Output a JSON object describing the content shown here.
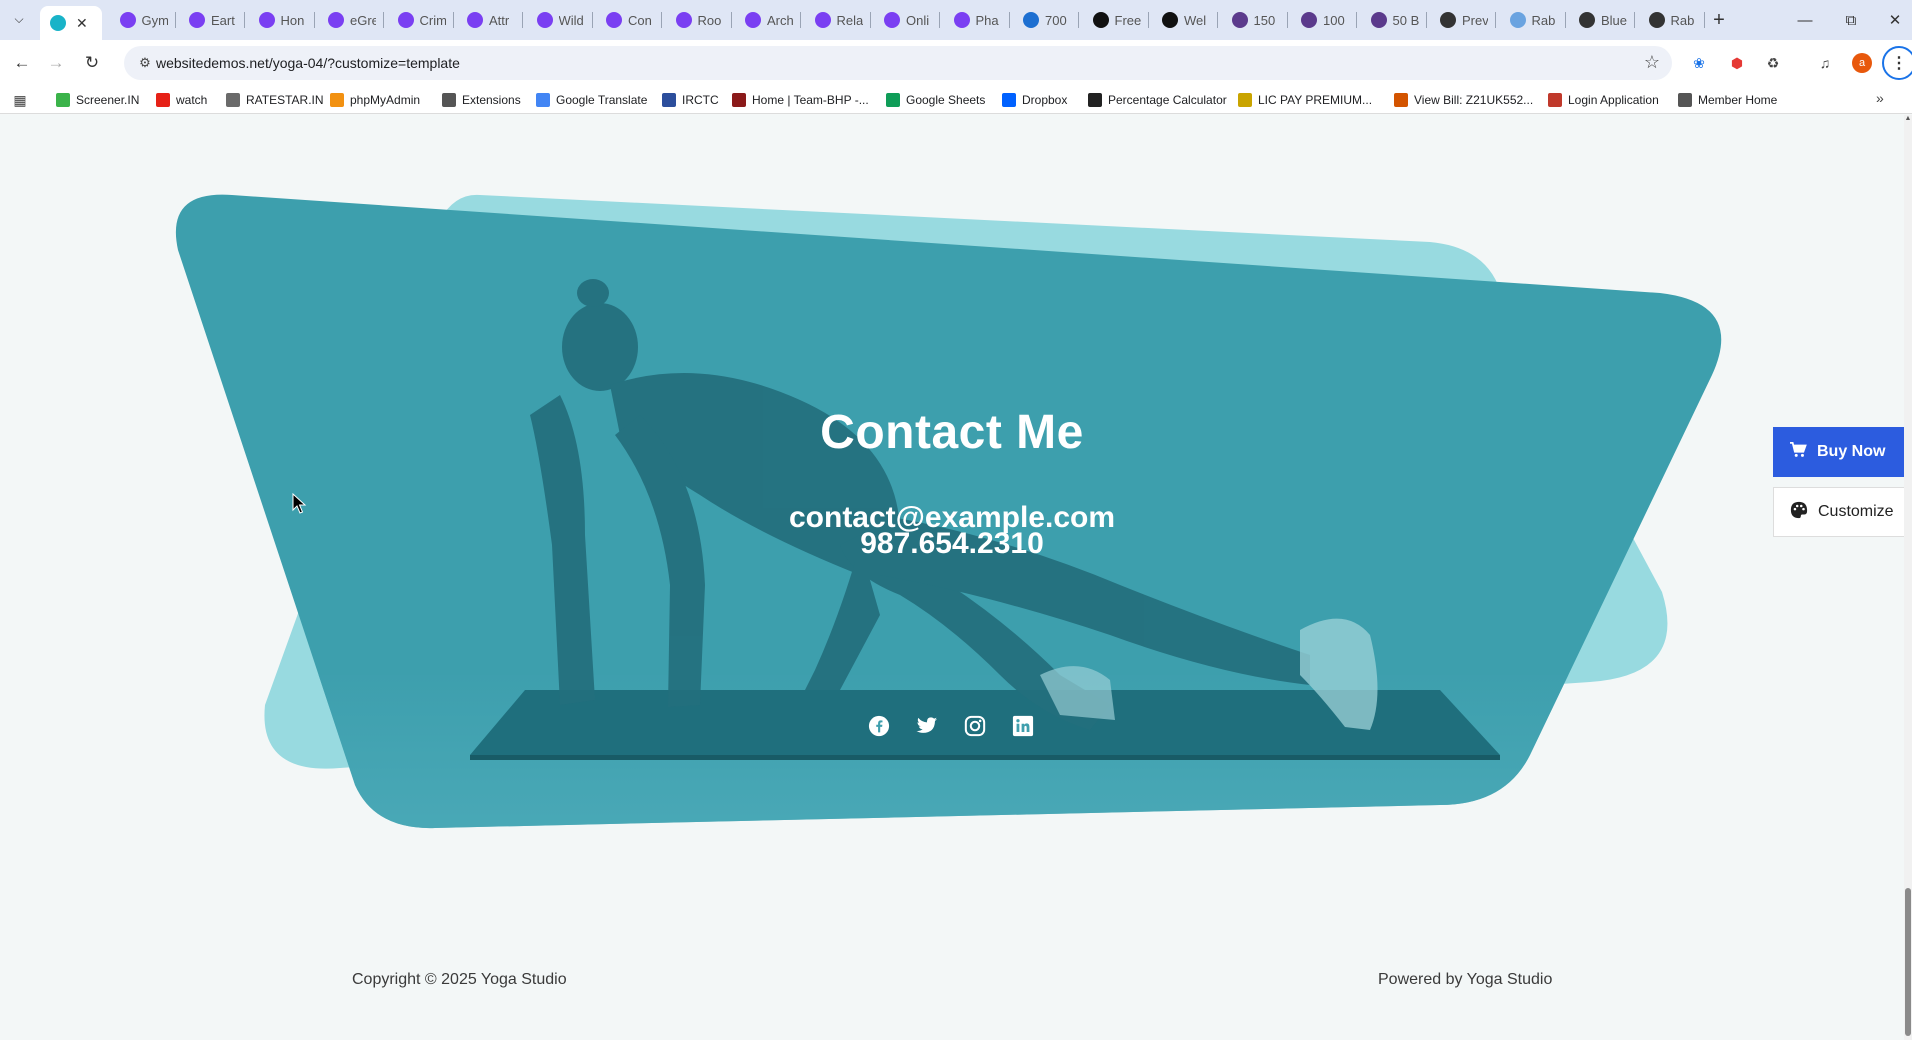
{
  "browser": {
    "tabs": [
      {
        "title": "",
        "favicon_color": "#19b3c8",
        "active": true
      },
      {
        "title": "Gym",
        "favicon_color": "#7a3ff2"
      },
      {
        "title": "Eart",
        "favicon_color": "#7a3ff2"
      },
      {
        "title": "Hon",
        "favicon_color": "#7a3ff2"
      },
      {
        "title": "eGre",
        "favicon_color": "#7a3ff2"
      },
      {
        "title": "Crim",
        "favicon_color": "#7a3ff2"
      },
      {
        "title": "Attr",
        "favicon_color": "#7a3ff2"
      },
      {
        "title": "Wild",
        "favicon_color": "#7a3ff2"
      },
      {
        "title": "Con",
        "favicon_color": "#7a3ff2"
      },
      {
        "title": "Roo",
        "favicon_color": "#7a3ff2"
      },
      {
        "title": "Arch",
        "favicon_color": "#7a3ff2"
      },
      {
        "title": "Rela",
        "favicon_color": "#7a3ff2"
      },
      {
        "title": "Onli",
        "favicon_color": "#7a3ff2"
      },
      {
        "title": "Pha",
        "favicon_color": "#7a3ff2"
      },
      {
        "title": "700",
        "favicon_color": "#1d6fd1"
      },
      {
        "title": "Free",
        "favicon_color": "#111111"
      },
      {
        "title": "Wel",
        "favicon_color": "#111111"
      },
      {
        "title": "150",
        "favicon_color": "#5b3a8c"
      },
      {
        "title": "100",
        "favicon_color": "#5b3a8c"
      },
      {
        "title": "50 B",
        "favicon_color": "#5b3a8c"
      },
      {
        "title": "Prev",
        "favicon_color": "#333333"
      },
      {
        "title": "Rab",
        "favicon_color": "#6aa3e0"
      },
      {
        "title": "Blue",
        "favicon_color": "#333333"
      },
      {
        "title": "Rab",
        "favicon_color": "#333333"
      }
    ],
    "url": "websitedemos.net/yoga-04/?customize=template",
    "bookmarks": [
      {
        "label": "Screener.IN",
        "color": "#3bb34a"
      },
      {
        "label": "watch",
        "color": "#e62117"
      },
      {
        "label": "RATESTAR.IN",
        "color": "#6a6a6a"
      },
      {
        "label": "phpMyAdmin",
        "color": "#f29111"
      },
      {
        "label": "Extensions",
        "color": "#555555"
      },
      {
        "label": "Google Translate",
        "color": "#4285f4"
      },
      {
        "label": "IRCTC",
        "color": "#2c4e9c"
      },
      {
        "label": "Home | Team-BHP -...",
        "color": "#8b1a1a"
      },
      {
        "label": "Google Sheets",
        "color": "#0f9d58"
      },
      {
        "label": "Dropbox",
        "color": "#0061ff"
      },
      {
        "label": "Percentage Calculator",
        "color": "#222222"
      },
      {
        "label": "LIC PAY PREMIUM...",
        "color": "#c9a400"
      },
      {
        "label": "View Bill: Z21UK552...",
        "color": "#d35400"
      },
      {
        "label": "Login Application",
        "color": "#c0392b"
      },
      {
        "label": "Member Home",
        "color": "#555555"
      }
    ]
  },
  "page": {
    "contact_title": "Contact Me",
    "email": "contact@example.com",
    "phone": "987.654.2310",
    "social_icons": [
      "facebook-icon",
      "twitter-icon",
      "instagram-icon",
      "linkedin-icon"
    ],
    "buy_label": "Buy Now",
    "customize_label": "Customize",
    "footer_left": "Copyright © 2025 Yoga Studio",
    "footer_right": "Powered by Yoga Studio",
    "colors": {
      "teal_main": "#3d9fad",
      "teal_light": "#9adbe0",
      "buy_blue": "#2c5cdf"
    }
  }
}
